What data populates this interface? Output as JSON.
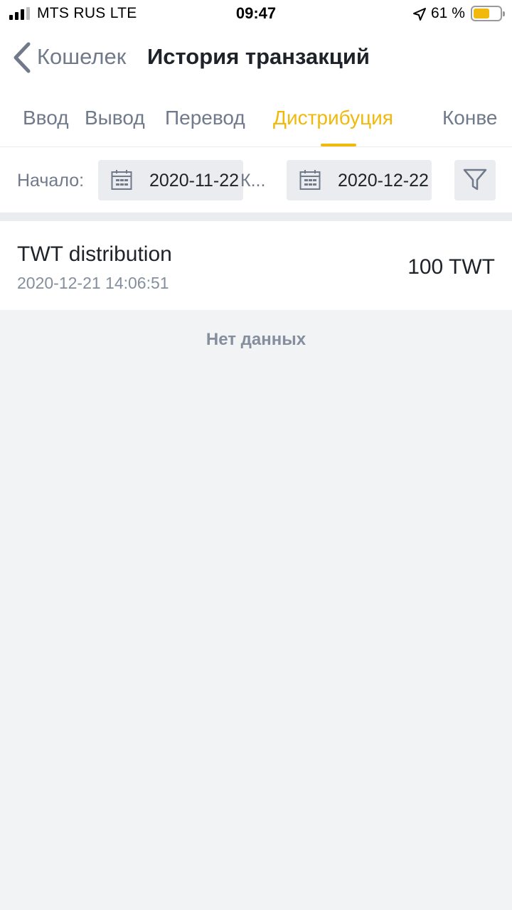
{
  "status_bar": {
    "carrier": "MTS RUS  LTE",
    "time": "09:47",
    "battery_percent": "61 %",
    "battery_level": 0.61,
    "battery_color": "#f0b90b"
  },
  "nav": {
    "back_label": "Кошелек",
    "title": "История транзакций"
  },
  "tabs": [
    {
      "label": "Ввод",
      "active": false
    },
    {
      "label": "Вывод",
      "active": false
    },
    {
      "label": "Перевод",
      "active": false
    },
    {
      "label": "Дистрибуция",
      "active": true
    },
    {
      "label": "Конве",
      "active": false
    }
  ],
  "filter": {
    "start_label": "Начало:",
    "from_date": "2020-11-22",
    "separator": "К...",
    "to_date": "2020-12-22"
  },
  "transactions": [
    {
      "title": "TWT distribution",
      "datetime": "2020-12-21 14:06:51",
      "amount": "100 TWT"
    }
  ],
  "empty_message": "Нет данных",
  "colors": {
    "accent": "#f0b90b",
    "text_primary": "#1e2329",
    "text_secondary": "#707a8a",
    "background": "#f2f3f5"
  }
}
